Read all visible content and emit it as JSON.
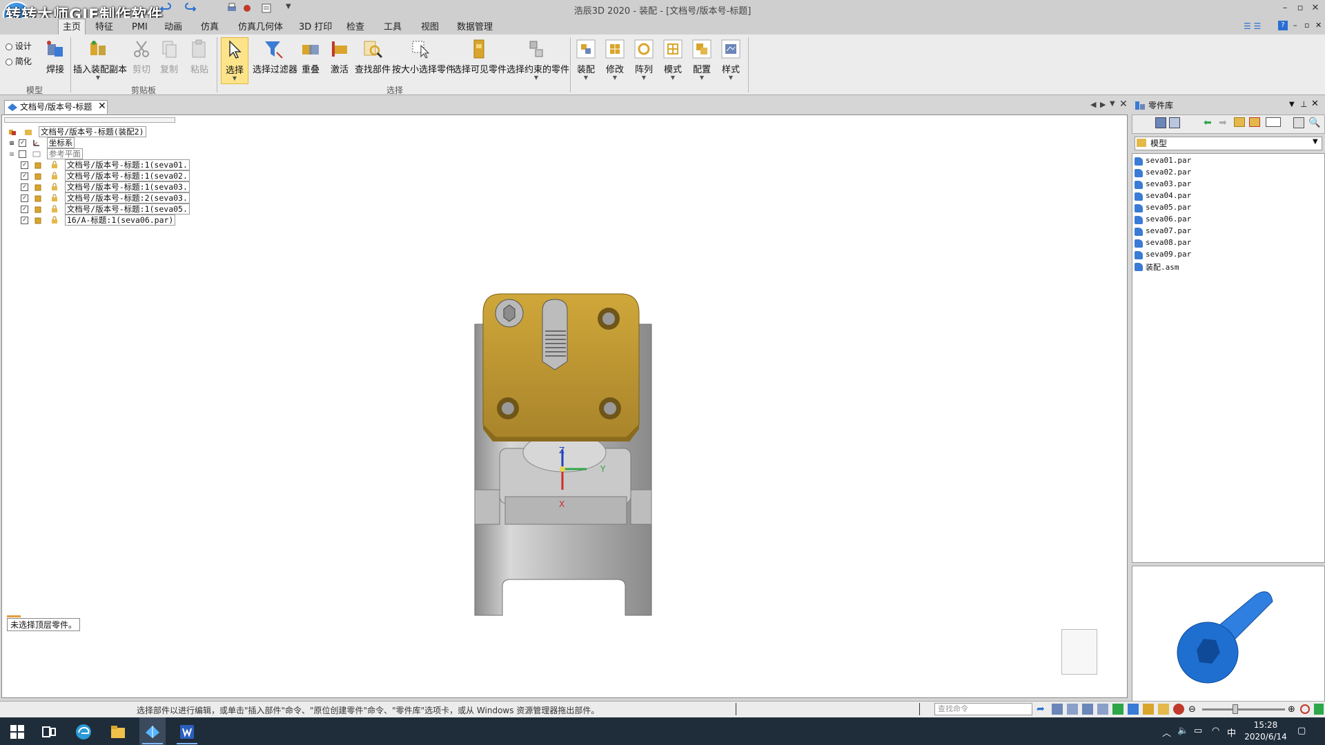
{
  "watermark": "转转大师GIF制作软件",
  "window": {
    "title": "浩辰3D 2020 - 装配 - [文档号/版本号-标题]"
  },
  "menu_tabs": [
    "主页",
    "特征",
    "PMI",
    "动画",
    "仿真",
    "仿真几何体",
    "3D 打印",
    "检查",
    "工具",
    "视图",
    "数据管理"
  ],
  "active_tab": "主页",
  "ribbon": {
    "mode_options": [
      "设计",
      "简化"
    ],
    "weld": "焊接",
    "groups": {
      "model": "模型",
      "clipboard": "剪贴板",
      "select": "选择"
    },
    "buttons": {
      "insert_copy": "插入装配副本",
      "cut": "剪切",
      "copy": "复制",
      "paste": "粘贴",
      "select": "选择",
      "select_filter": "选择过滤器",
      "overlap": "重叠",
      "activate": "激活",
      "find_part": "查找部件",
      "select_by_size": "按大小选择零件",
      "select_visible": "选择可见零件",
      "select_constrained": "选择约束的零件",
      "assembly": "装配",
      "modify": "修改",
      "pattern": "阵列",
      "mode": "模式",
      "config": "配置",
      "style": "样式"
    }
  },
  "doc_tab": {
    "label": "文档号/版本号-标题"
  },
  "tree": {
    "root": "文档号/版本号-标题(装配2)",
    "items": [
      {
        "label": "坐标系",
        "checked": true
      },
      {
        "label": "参考平面",
        "checked": false
      },
      {
        "label": "文档号/版本号-标题:1(seva01.",
        "checked": true
      },
      {
        "label": "文档号/版本号-标题:1(seva02.",
        "checked": true
      },
      {
        "label": "文档号/版本号-标题:1(seva03.",
        "checked": true
      },
      {
        "label": "文档号/版本号-标题:2(seva03.",
        "checked": true
      },
      {
        "label": "文档号/版本号-标题:1(seva05.",
        "checked": true
      },
      {
        "label": "16/A-标题:1(seva06.par)",
        "checked": true
      }
    ]
  },
  "viewport": {
    "status_chip": "未选择顶层零件。",
    "axes": {
      "z": "Z",
      "y": "Y",
      "x": "X"
    }
  },
  "parts_library": {
    "title": "零件库",
    "folder": "模型",
    "files": [
      "seva01.par",
      "seva02.par",
      "seva03.par",
      "seva04.par",
      "seva05.par",
      "seva06.par",
      "seva07.par",
      "seva08.par",
      "seva09.par",
      "装配.asm"
    ]
  },
  "statusbar": {
    "message": "选择部件以进行编辑，或单击\"插入部件\"命令、\"原位创建零件\"命令、\"零件库\"选项卡，或从 Windows 资源管理器拖出部件。",
    "search_placeholder": "查找命令"
  },
  "taskbar": {
    "time": "15:28",
    "date": "2020/6/14",
    "ime": "中"
  },
  "colors": {
    "accent": "#fde48a",
    "part_gold": "#c9a23a",
    "part_blue": "#1f6fd1"
  }
}
